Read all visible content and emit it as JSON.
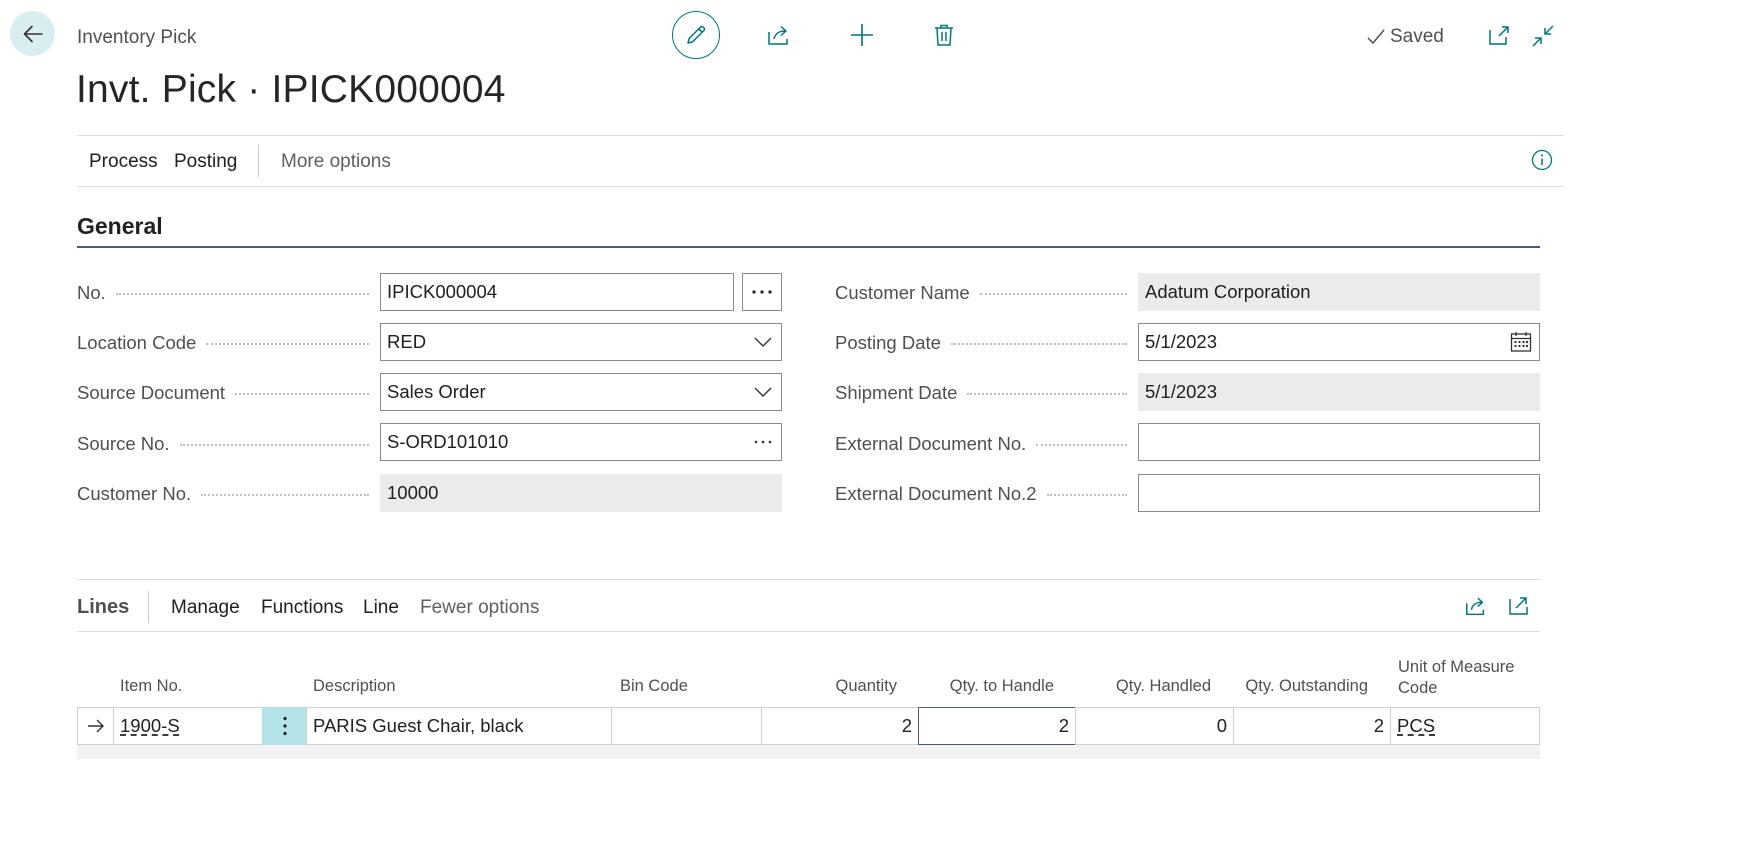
{
  "header": {
    "caption": "Inventory Pick",
    "title": "Invt. Pick · IPICK000004",
    "status": "Saved"
  },
  "actions": {
    "process": "Process",
    "posting": "Posting",
    "more_options": "More options"
  },
  "general": {
    "section_title": "General",
    "left": [
      {
        "label": "No.",
        "value": "IPICK000004",
        "kind": "text-assist"
      },
      {
        "label": "Location Code",
        "value": "RED",
        "kind": "dropdown"
      },
      {
        "label": "Source Document",
        "value": "Sales Order",
        "kind": "dropdown"
      },
      {
        "label": "Source No.",
        "value": "S-ORD101010",
        "kind": "lookup"
      },
      {
        "label": "Customer No.",
        "value": "10000",
        "kind": "readonly"
      }
    ],
    "right": [
      {
        "label": "Customer Name",
        "value": "Adatum Corporation",
        "kind": "readonly"
      },
      {
        "label": "Posting Date",
        "value": "5/1/2023",
        "kind": "date"
      },
      {
        "label": "Shipment Date",
        "value": "5/1/2023",
        "kind": "readonly"
      },
      {
        "label": "External Document No.",
        "value": "",
        "kind": "text"
      },
      {
        "label": "External Document No.2",
        "value": "",
        "kind": "text"
      }
    ]
  },
  "lines": {
    "title": "Lines",
    "actions": {
      "manage": "Manage",
      "functions": "Functions",
      "line": "Line",
      "fewer_options": "Fewer options"
    },
    "columns": {
      "item_no": "Item No.",
      "description": "Description",
      "bin_code": "Bin Code",
      "quantity": "Quantity",
      "qty_to_handle": "Qty. to Handle",
      "qty_handled": "Qty. Handled",
      "qty_outstanding": "Qty. Outstanding",
      "uom_line1": "Unit of Measure",
      "uom_line2": "Code"
    },
    "rows": [
      {
        "item_no": "1900-S",
        "description": "PARIS Guest Chair, black",
        "bin_code": "",
        "quantity": "2",
        "qty_to_handle": "2",
        "qty_handled": "0",
        "qty_outstanding": "2",
        "uom": "PCS"
      }
    ]
  },
  "colors": {
    "accent": "#00767c",
    "back_button_bg": "#d9eef0",
    "readonly_field_bg": "#ebebeb",
    "selected_cell_bg": "#b4e3e8",
    "section_rule": "#505a6e"
  },
  "icons": [
    "arrow-left-icon",
    "pencil-icon",
    "share-icon",
    "plus-icon",
    "trash-icon",
    "check-icon",
    "open-new-window-icon",
    "collapse-icon",
    "info-icon",
    "chevron-down-icon",
    "ellipsis-icon",
    "calendar-icon",
    "arrow-right-icon",
    "vertical-ellipsis-icon",
    "expand-icon"
  ]
}
